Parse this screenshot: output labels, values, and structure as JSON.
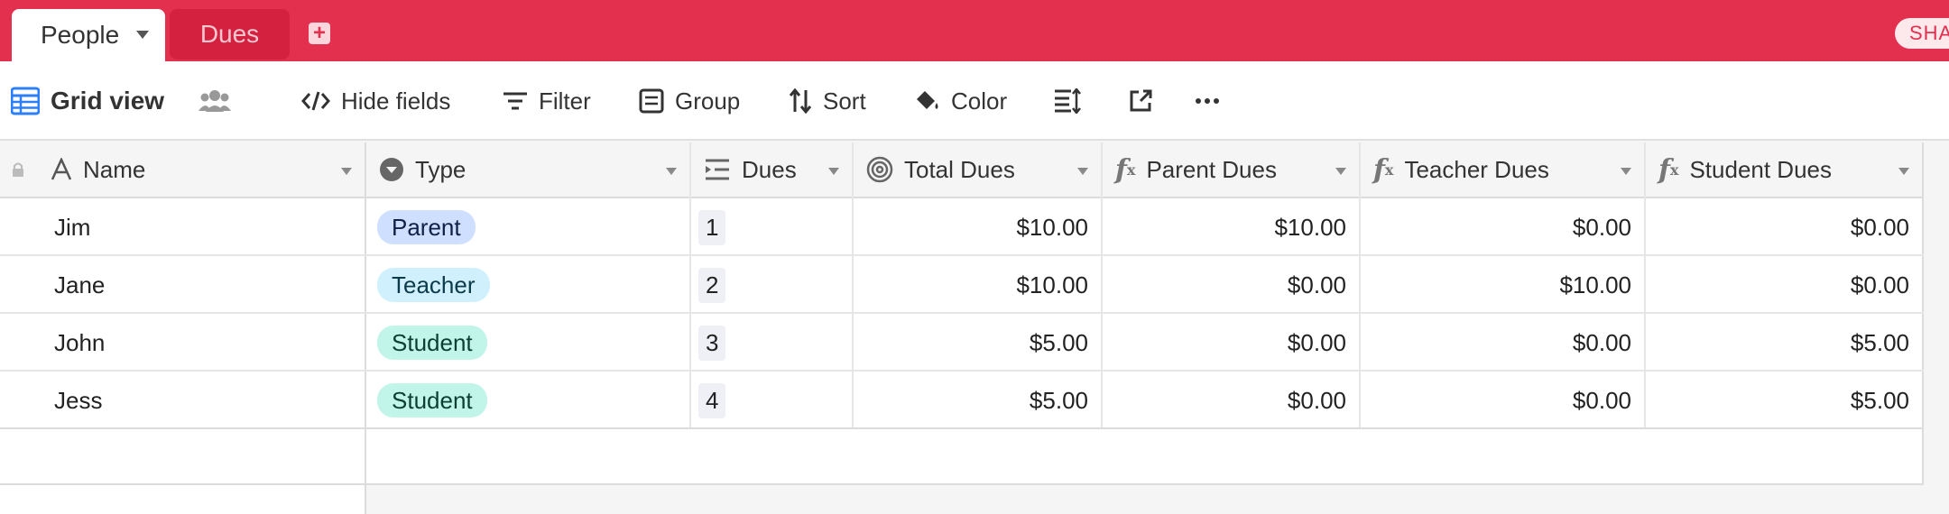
{
  "tabs": [
    {
      "label": "People",
      "active": true
    },
    {
      "label": "Dues",
      "active": false
    }
  ],
  "share_label": "SHA",
  "toolbar": {
    "view_name": "Grid view",
    "hide_fields": "Hide fields",
    "filter": "Filter",
    "group": "Group",
    "sort": "Sort",
    "color": "Color"
  },
  "columns": [
    {
      "label": "Name",
      "icon": "text-field-icon"
    },
    {
      "label": "Type",
      "icon": "single-select-icon"
    },
    {
      "label": "Dues",
      "icon": "link-records-icon"
    },
    {
      "label": "Total Dues",
      "icon": "rollup-icon"
    },
    {
      "label": "Parent Dues",
      "icon": "formula-icon"
    },
    {
      "label": "Teacher Dues",
      "icon": "formula-icon"
    },
    {
      "label": "Student Dues",
      "icon": "formula-icon"
    }
  ],
  "rows": [
    {
      "name": "Jim",
      "type": "Parent",
      "dues": "1",
      "total": "$10.00",
      "parent": "$10.00",
      "teacher": "$0.00",
      "student": "$0.00"
    },
    {
      "name": "Jane",
      "type": "Teacher",
      "dues": "2",
      "total": "$10.00",
      "parent": "$0.00",
      "teacher": "$10.00",
      "student": "$0.00"
    },
    {
      "name": "John",
      "type": "Student",
      "dues": "3",
      "total": "$5.00",
      "parent": "$0.00",
      "teacher": "$0.00",
      "student": "$5.00"
    },
    {
      "name": "Jess",
      "type": "Student",
      "dues": "4",
      "total": "$5.00",
      "parent": "$0.00",
      "teacher": "$0.00",
      "student": "$5.00"
    }
  ],
  "colors": {
    "topbar": "#e3304f",
    "grid_icon": "#2d7ff9"
  }
}
